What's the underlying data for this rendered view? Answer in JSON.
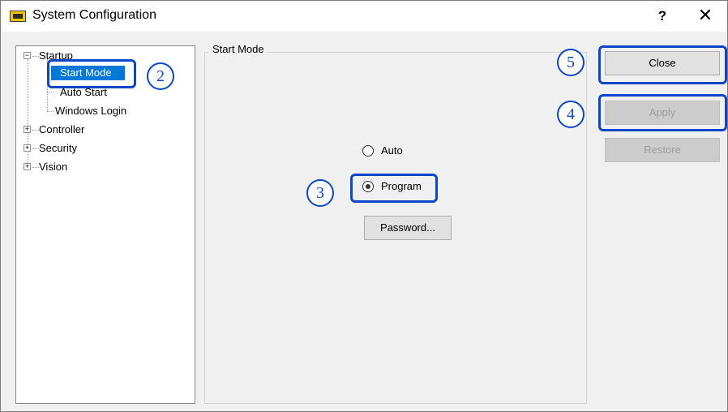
{
  "window": {
    "title": "System Configuration",
    "help": "?",
    "close": "✕"
  },
  "tree": {
    "startup": "Startup",
    "start_mode": "Start Mode",
    "auto_start": "Auto Start",
    "windows_login": "Windows Login",
    "controller": "Controller",
    "security": "Security",
    "vision": "Vision",
    "collapse_glyph": "−",
    "expand_glyph": "+"
  },
  "panel": {
    "title": "Start Mode",
    "radio_auto": "Auto",
    "radio_program": "Program",
    "selected_mode": "Program",
    "password_button": "Password..."
  },
  "buttons": {
    "close": "Close",
    "apply": "Apply",
    "restore": "Restore"
  },
  "callouts": {
    "c2": "2",
    "c3": "3",
    "c4": "4",
    "c5": "5"
  },
  "colors": {
    "highlight": "#0d47c7",
    "selection": "#0078d7"
  }
}
